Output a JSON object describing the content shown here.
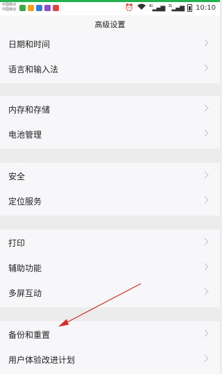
{
  "status_bar": {
    "carrier_line1": "中国移动",
    "carrier_line2": "中国移动",
    "network_1": "4G",
    "network_2": "3G",
    "time": "10:10",
    "app_icon_colors": [
      "#3aa84a",
      "#f0a41e",
      "#3a7bd5",
      "#8a4fd0",
      "#d94848"
    ]
  },
  "header": {
    "title": "高级设置"
  },
  "settings": {
    "items": [
      {
        "label": "日期和时间"
      },
      {
        "label": "语言和输入法"
      },
      {
        "label": "内存和存储"
      },
      {
        "label": "电池管理"
      },
      {
        "label": "安全"
      },
      {
        "label": "定位服务"
      },
      {
        "label": "打印"
      },
      {
        "label": "辅助功能"
      },
      {
        "label": "多屏互动"
      },
      {
        "label": "备份和重置"
      },
      {
        "label": "用户体验改进计划"
      }
    ]
  },
  "annotation": {
    "arrow_color": "#d42a2a",
    "points_to": "备份和重置"
  },
  "colors": {
    "status_accent": "#22b14c",
    "row_background": "#f7f6f8",
    "group_gap": "#ececec"
  }
}
